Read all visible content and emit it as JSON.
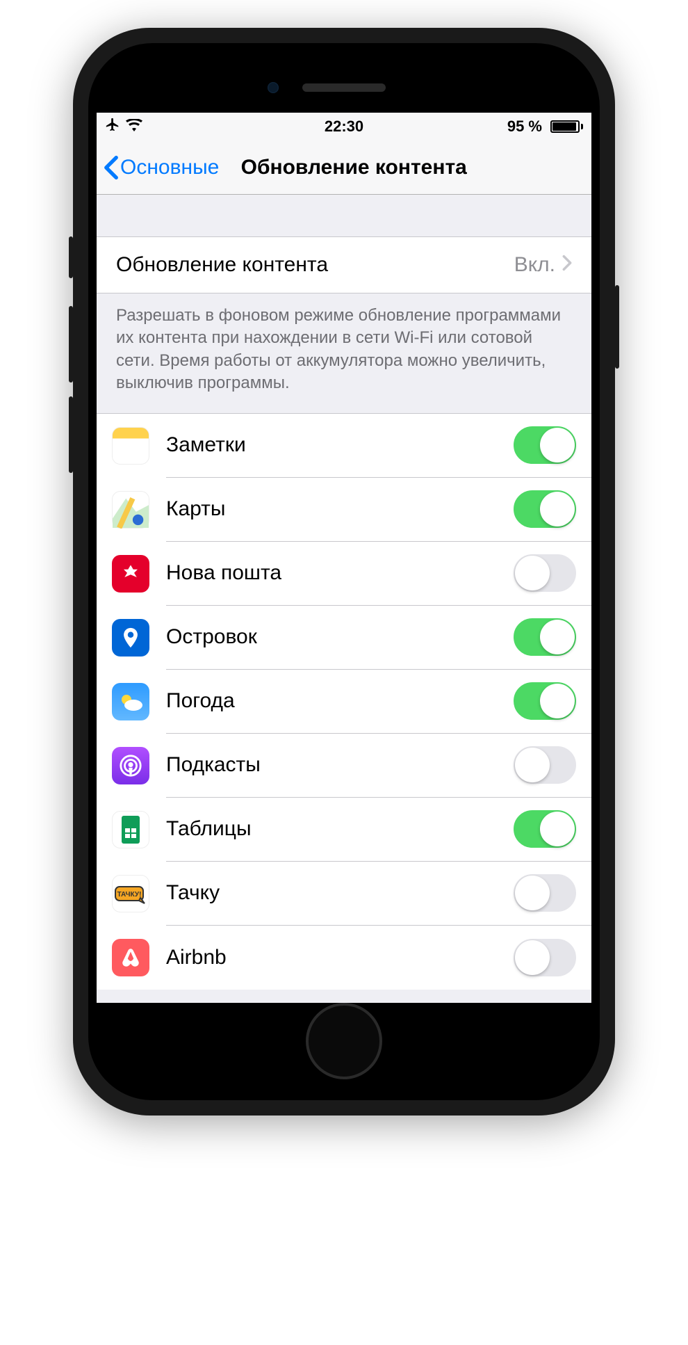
{
  "status": {
    "time": "22:30",
    "battery_pct": "95 %"
  },
  "nav": {
    "back_label": "Основные",
    "title": "Обновление контента"
  },
  "master": {
    "label": "Обновление контента",
    "value": "Вкл."
  },
  "footer": "Разрешать в фоновом режиме обновление программами их контента при нахождении в сети Wi-Fi или сотовой сети. Время работы от аккумулятора можно увеличить, выключив программы.",
  "apps": [
    {
      "name": "Заметки",
      "on": true,
      "icon": "notes"
    },
    {
      "name": "Карты",
      "on": true,
      "icon": "maps"
    },
    {
      "name": "Нова пошта",
      "on": false,
      "icon": "nova"
    },
    {
      "name": "Островок",
      "on": true,
      "icon": "ostrov"
    },
    {
      "name": "Погода",
      "on": true,
      "icon": "weather"
    },
    {
      "name": "Подкасты",
      "on": false,
      "icon": "podcast"
    },
    {
      "name": "Таблицы",
      "on": true,
      "icon": "sheets"
    },
    {
      "name": "Тачку",
      "on": false,
      "icon": "tachku"
    },
    {
      "name": "Airbnb",
      "on": false,
      "icon": "airbnb"
    }
  ]
}
